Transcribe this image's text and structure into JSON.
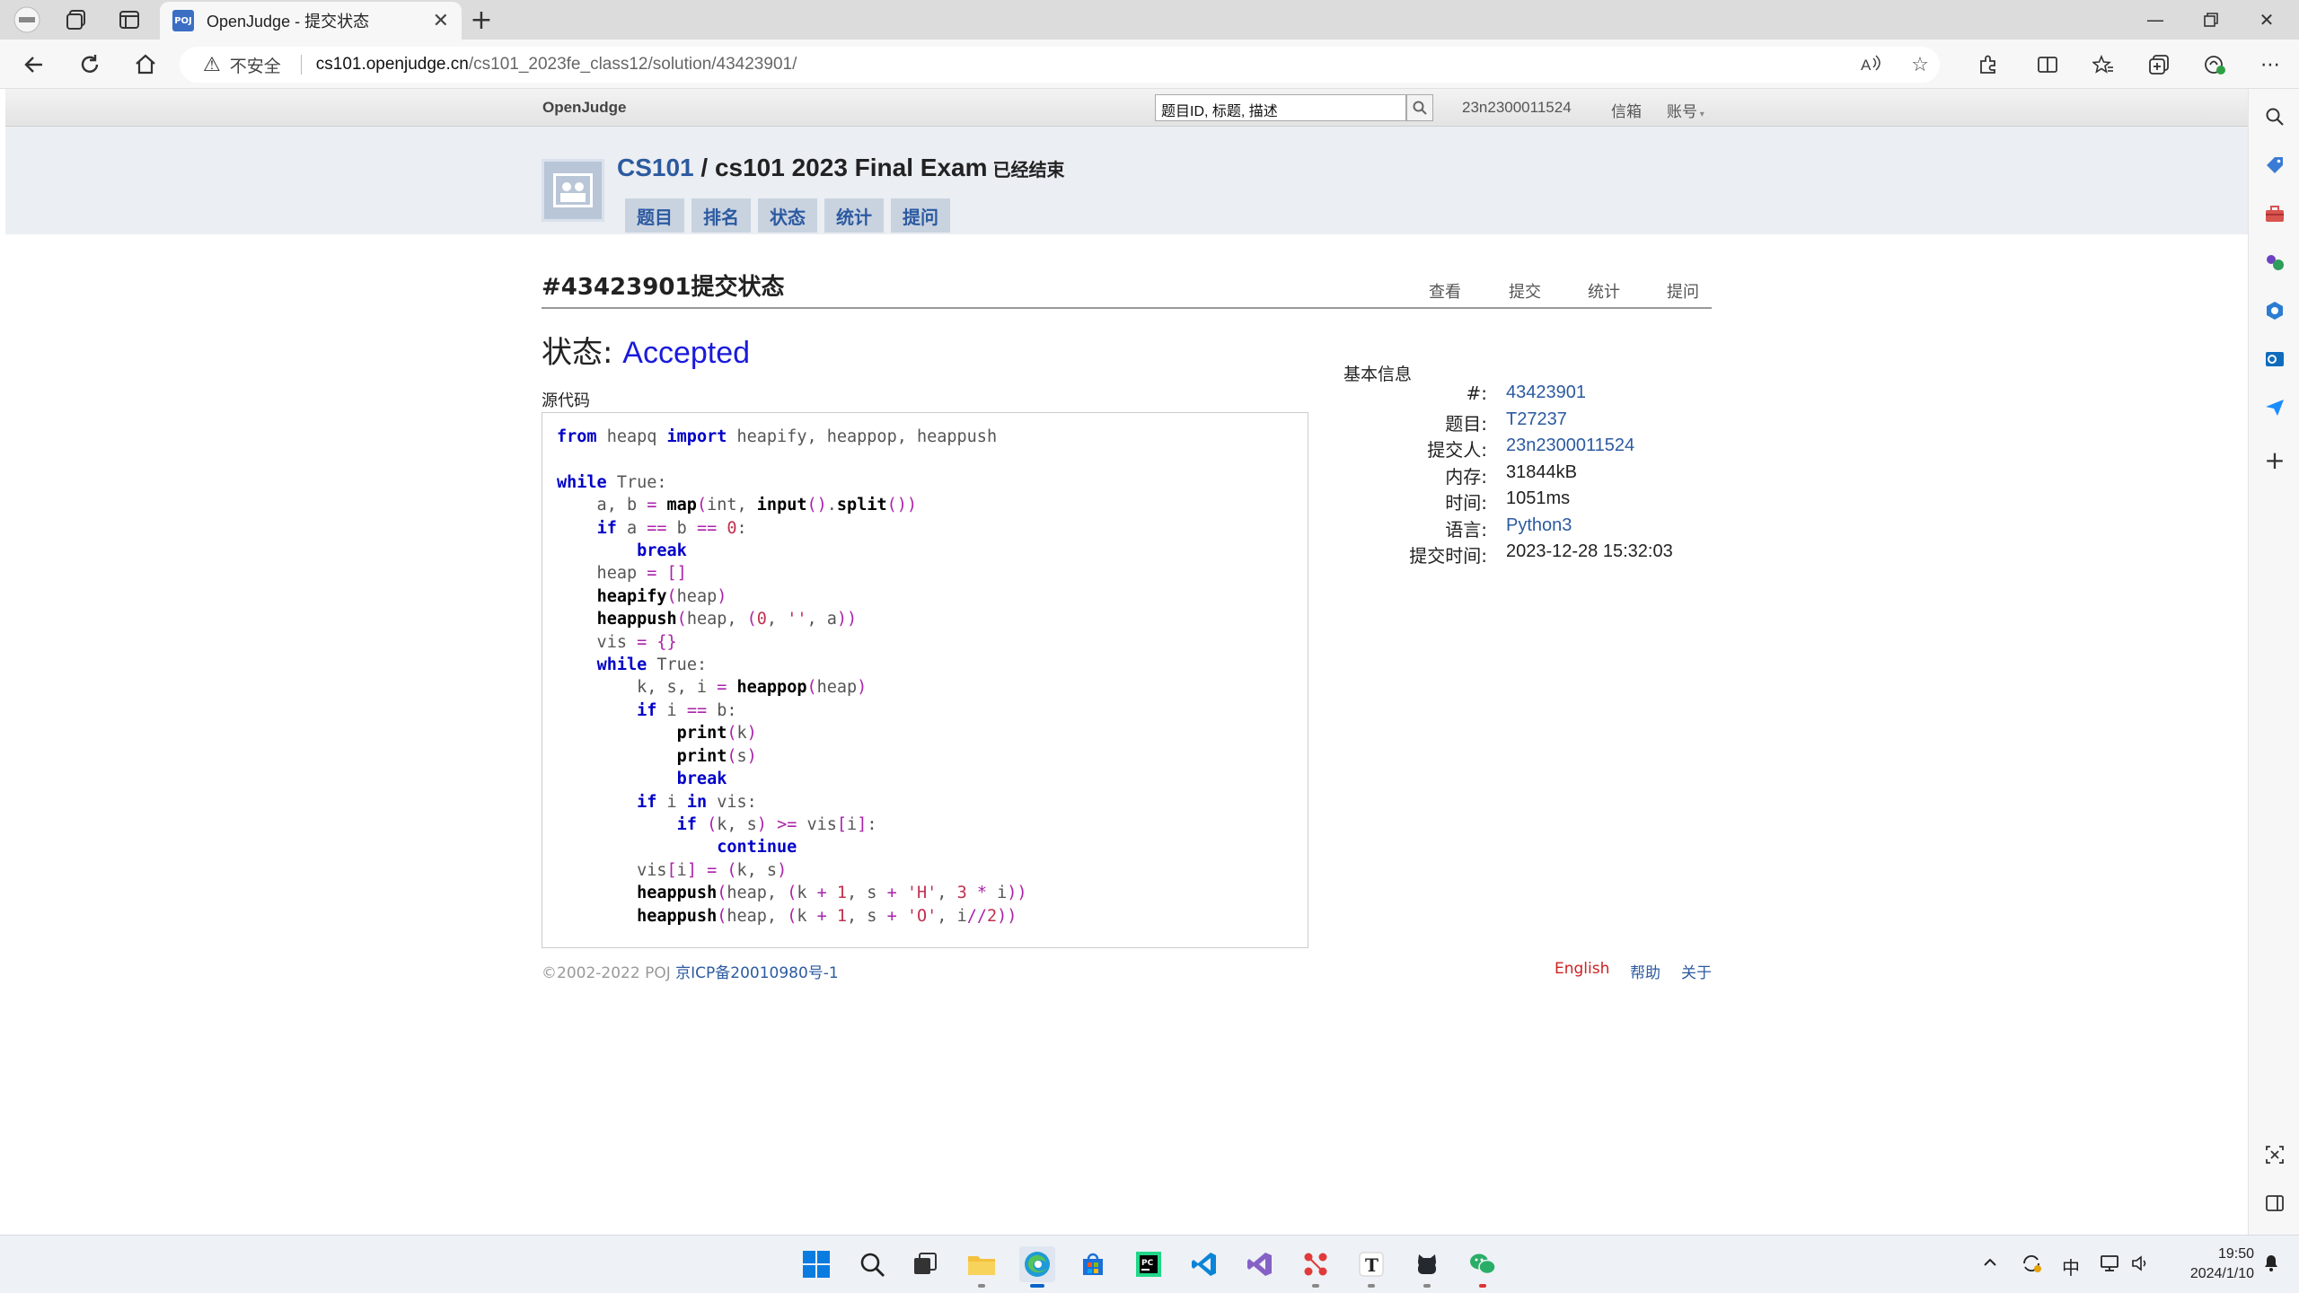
{
  "browser": {
    "tab": {
      "favicon_text": "POJ",
      "title": "OpenJudge - 提交状态"
    },
    "address": {
      "security_label": "不安全",
      "host": "cs101.openjudge.cn",
      "path": "/cs101_2023fe_class12/solution/43423901/"
    }
  },
  "site": {
    "logo": "OpenJudge",
    "search_value": "题目ID, 标题, 描述",
    "username": "23n2300011524",
    "mailbox": "信箱",
    "account": "账号"
  },
  "contest": {
    "course": "CS101",
    "separator": " / ",
    "name": "cs101 2023 Final Exam",
    "state": "已经结束",
    "tabs": [
      "题目",
      "排名",
      "状态",
      "统计",
      "提问"
    ]
  },
  "submission": {
    "heading": "#43423901提交状态",
    "sub_links": [
      "查看",
      "提交",
      "统计",
      "提问"
    ],
    "status_label": "状态: ",
    "status": "Accepted",
    "source_label": "源代码",
    "code_lines": [
      "from heapq import heapify, heappop, heappush",
      "",
      "while True:",
      "    a, b = map(int, input().split())",
      "    if a == b == 0:",
      "        break",
      "    heap = []",
      "    heapify(heap)",
      "    heappush(heap, (0, '', a))",
      "    vis = {}",
      "    while True:",
      "        k, s, i = heappop(heap)",
      "        if i == b:",
      "            print(k)",
      "            print(s)",
      "            break",
      "        if i in vis:",
      "            if (k, s) >= vis[i]:",
      "                continue",
      "        vis[i] = (k, s)",
      "        heappush(heap, (k + 1, s + 'H', 3 * i))",
      "        heappush(heap, (k + 1, s + 'O', i//2))"
    ]
  },
  "info": {
    "title": "基本信息",
    "rows": [
      {
        "key": "#:",
        "value": "43423901",
        "link": true
      },
      {
        "key": "题目:",
        "value": "T27237",
        "link": true
      },
      {
        "key": "提交人:",
        "value": "23n2300011524",
        "link": true
      },
      {
        "key": "内存:",
        "value": "31844kB",
        "link": false
      },
      {
        "key": "时间:",
        "value": "1051ms",
        "link": false
      },
      {
        "key": "语言:",
        "value": "Python3",
        "link": true
      },
      {
        "key": "提交时间:",
        "value": "2023-12-28 15:32:03",
        "link": false
      }
    ]
  },
  "footer": {
    "copyright": "©2002-2022 POJ ",
    "icp": "京ICP备20010980号-1",
    "links": [
      "English",
      "帮助",
      "关于"
    ]
  },
  "taskbar": {
    "ime": "中",
    "time": "19:50",
    "date": "2024/1/10"
  },
  "colors": {
    "link": "#2c5aa0",
    "accepted": "#1a1adc",
    "keyword": "#0000c8",
    "english_link": "#cc2222"
  }
}
